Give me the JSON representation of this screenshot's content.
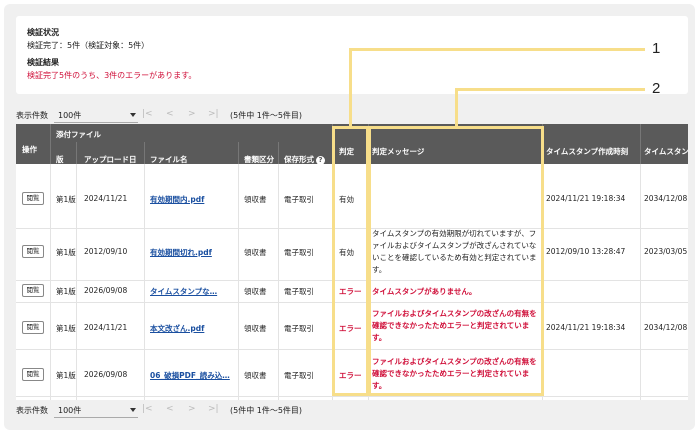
{
  "status": {
    "verify_title": "検証状況",
    "verify_text": "検証完了：5件（検証対象：5件）",
    "result_title": "検証結果",
    "result_text": "検証完了5件のうち、3件のエラーがあります。"
  },
  "pager_top": {
    "count_label": "表示件数",
    "count_value": "100件",
    "first": "|<",
    "prev": "<",
    "next": ">",
    "last": ">|",
    "range": "(5件中 1件〜5件目)"
  },
  "pager_bottom": {
    "count_label": "表示件数",
    "count_value": "100件",
    "first": "|<",
    "prev": "<",
    "next": ">",
    "last": ">|",
    "range": "(5件中 1件〜5件目)"
  },
  "table": {
    "group_header": "添付ファイル",
    "headers": {
      "op": "操作",
      "version": "版",
      "upload_date": "アップロード日",
      "file_name": "ファイル名",
      "doc_type": "書類区分",
      "storage": "保存形式",
      "judgment": "判定",
      "message": "判定メッセージ",
      "ts_created": "タイムスタンプ作成時刻",
      "ts_expire": "タイムスタン"
    },
    "help_icon": "?",
    "view_label": "閲覧",
    "rows": [
      {
        "version": "第1版",
        "upload_date": "2024/11/21",
        "file_name": "有効期間内.pdf",
        "doc_type": "領収書",
        "storage": "電子取引",
        "judgment": "有効",
        "message": "",
        "ts_created": "2024/11/21 19:18:34",
        "ts_expire": "2034/12/08"
      },
      {
        "version": "第1版",
        "upload_date": "2012/09/10",
        "file_name": "有効期間切れ.pdf",
        "doc_type": "領収書",
        "storage": "電子取引",
        "judgment": "有効",
        "message": "タイムスタンプの有効期限が切れていますが、ファイルおよびタイムスタンプが改ざんされていないことを確認しているため有効と判定されています。",
        "ts_created": "2012/09/10 13:28:47",
        "ts_expire": "2023/03/05"
      },
      {
        "version": "第1版",
        "upload_date": "2026/09/08",
        "file_name": "タイムスタンプな…",
        "doc_type": "領収書",
        "storage": "電子取引",
        "judgment": "エラー",
        "message": "タイムスタンプがありません。",
        "ts_created": "",
        "ts_expire": ""
      },
      {
        "version": "第1版",
        "upload_date": "2024/11/21",
        "file_name": "本文改ざん.pdf",
        "doc_type": "領収書",
        "storage": "電子取引",
        "judgment": "エラー",
        "message": "ファイルおよびタイムスタンプの改ざんの有無を確認できなかったためエラーと判定されています。",
        "ts_created": "2024/11/21 19:18:34",
        "ts_expire": "2034/12/08"
      },
      {
        "version": "第1版",
        "upload_date": "2026/09/08",
        "file_name": "06_破損PDF_読み込…",
        "doc_type": "領収書",
        "storage": "電子取引",
        "judgment": "エラー",
        "message": "ファイルおよびタイムスタンプの改ざんの有無を確認できなかったためエラーと判定されています。",
        "ts_created": "",
        "ts_expire": ""
      }
    ]
  },
  "callouts": {
    "one": "1",
    "two": "2"
  },
  "colors": {
    "header_bg": "#5a5a5a",
    "error": "#d0103a",
    "link": "#1a4fa0",
    "highlight": "#f7de8a"
  }
}
